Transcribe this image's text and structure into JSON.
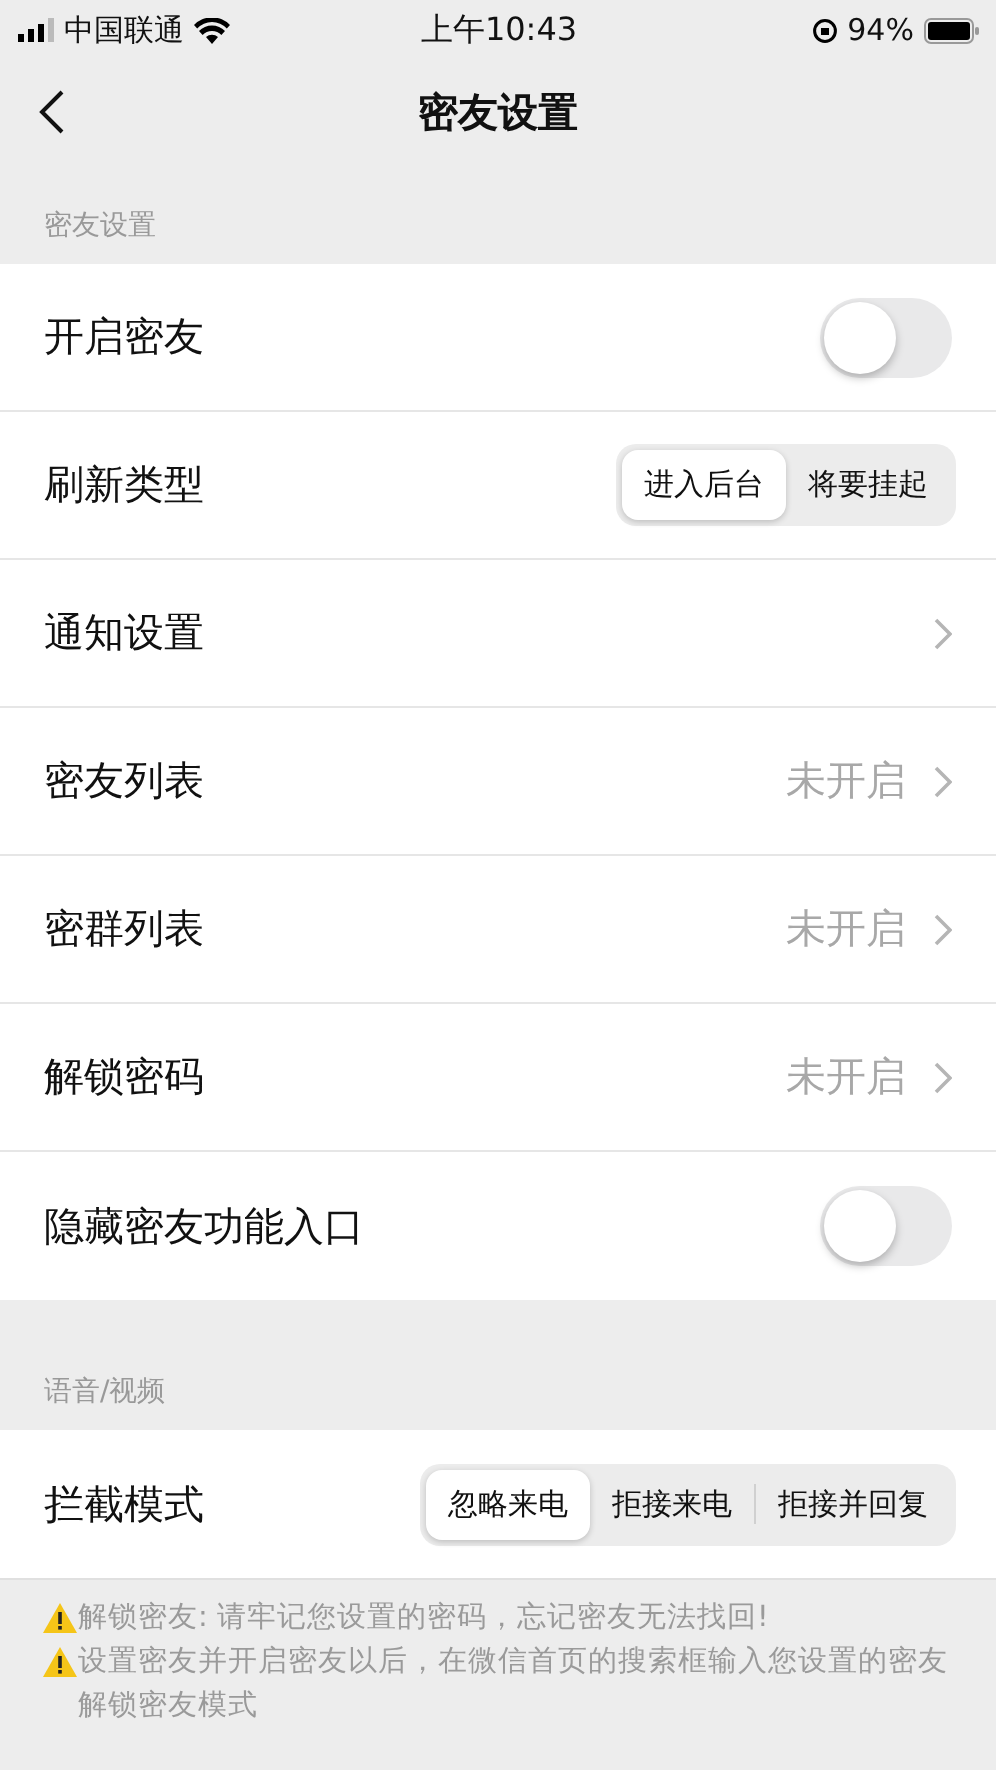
{
  "status_bar": {
    "carrier": "中国联通",
    "time": "上午10:43",
    "battery": "94%"
  },
  "nav": {
    "title": "密友设置"
  },
  "sections": [
    {
      "header": "密友设置",
      "rows": [
        {
          "kind": "toggle",
          "label": "开启密友",
          "on": false
        },
        {
          "kind": "segmented",
          "label": "刷新类型",
          "options": [
            {
              "label": "进入后台",
              "selected": true
            },
            {
              "label": "将要挂起",
              "selected": false
            }
          ]
        },
        {
          "kind": "link",
          "label": "通知设置"
        },
        {
          "kind": "link",
          "label": "密友列表",
          "value": "未开启"
        },
        {
          "kind": "link",
          "label": "密群列表",
          "value": "未开启"
        },
        {
          "kind": "link",
          "label": "解锁密码",
          "value": "未开启"
        },
        {
          "kind": "toggle",
          "label": "隐藏密友功能入口",
          "on": false
        }
      ]
    },
    {
      "header": "语音/视频",
      "rows": [
        {
          "kind": "segmented",
          "label": "拦截模式",
          "options": [
            {
              "label": "忽略来电",
              "selected": true
            },
            {
              "label": "拒接来电",
              "selected": false
            },
            {
              "label": "拒接并回复",
              "selected": false
            }
          ]
        }
      ]
    }
  ],
  "notes": [
    {
      "text": "解锁密友: 请牢记您设置的密码，忘记密友无法找回!"
    },
    {
      "text": "设置密友并开启密友以后，在微信首页的搜索框输入您设置的密友解锁密友模式"
    }
  ]
}
